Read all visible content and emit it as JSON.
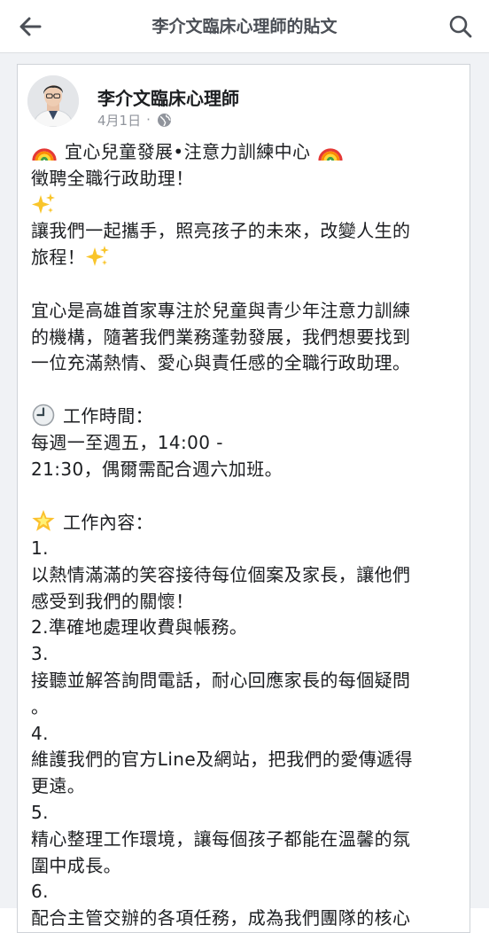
{
  "header": {
    "title": "李介文臨床心理師的貼文"
  },
  "post": {
    "author": "李介文臨床心理師",
    "date": "4月1日",
    "separator": "·",
    "lines": {
      "l1": "宜心兒童發展•注意力訓練中心",
      "l2": "徵聘全職行政助理！",
      "l4": "讓我們一起攜手，照亮孩子的未來，改變人生的",
      "l5": "旅程！",
      "l7": "宜心是高雄首家專注於兒童與青少年注意力訓練",
      "l8": "的機構，隨著我們業務蓬勃發展，我們想要找到",
      "l9": "一位充滿熱情、愛心與責任感的全職行政助理。",
      "l11": "工作時間：",
      "l12": "每週一至週五，14:00 -",
      "l13": "21:30，偶爾需配合週六加班。",
      "l15": "工作內容：",
      "l16": "1.",
      "l17": "以熱情滿滿的笑容接待每位個案及家長，讓他們",
      "l18": "感受到我們的關懷！",
      "l19": "2.準確地處理收費與帳務。",
      "l20": "3.",
      "l21": "接聽並解答詢問電話，耐心回應家長的每個疑問",
      "l22": "。",
      "l23": "4.",
      "l24": "維護我們的官方Line及網站，把我們的愛傳遞得",
      "l25": "更遠。",
      "l26": "5.",
      "l27": "精心整理工作環境，讓每個孩子都能在溫馨的氛",
      "l28": "圍中成長。",
      "l29": "6.",
      "l30": "配合主管交辦的各項任務，成為我們團隊的核心"
    }
  }
}
